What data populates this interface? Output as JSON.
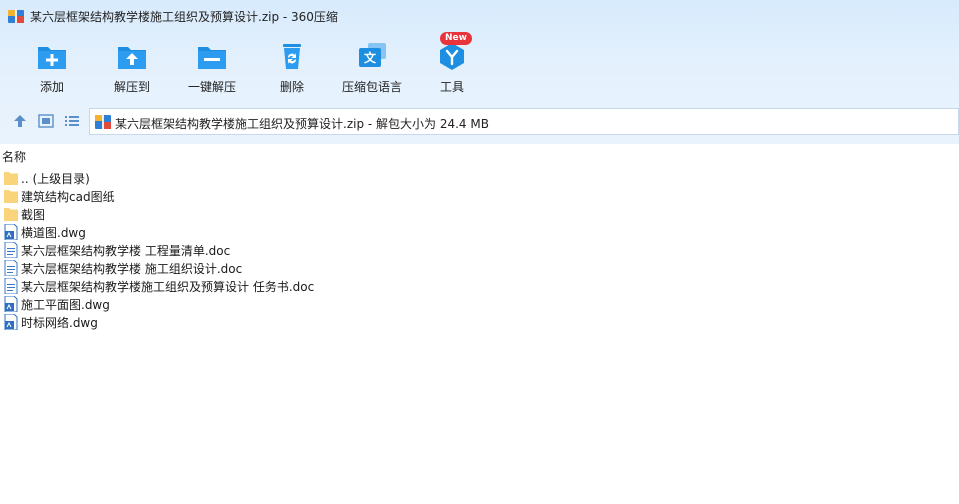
{
  "window": {
    "title": "某六层框架结构教学楼施工组织及预算设计.zip - 360压缩",
    "app_icon": "archive-icon"
  },
  "toolbar": {
    "buttons": [
      {
        "label": "添加",
        "icon": "add-folder-icon"
      },
      {
        "label": "解压到",
        "icon": "extract-folder-icon"
      },
      {
        "label": "一键解压",
        "icon": "one-click-extract-icon"
      },
      {
        "label": "删除",
        "icon": "recycle-bin-icon"
      },
      {
        "label": "压缩包语言",
        "icon": "language-icon"
      },
      {
        "label": "工具",
        "icon": "tools-icon"
      }
    ],
    "new_badge": "New"
  },
  "address": {
    "text": "某六层框架结构教学楼施工组织及预算设计.zip - 解包大小为 24.4 MB"
  },
  "file_list": {
    "column_header": "名称",
    "items": [
      {
        "name": ".. (上级目录)",
        "type": "folder"
      },
      {
        "name": "建筑结构cad图纸",
        "type": "folder"
      },
      {
        "name": "截图",
        "type": "folder"
      },
      {
        "name": "横道图.dwg",
        "type": "dwg"
      },
      {
        "name": "某六层框架结构教学楼 工程量清单.doc",
        "type": "doc"
      },
      {
        "name": "某六层框架结构教学楼 施工组织设计.doc",
        "type": "doc"
      },
      {
        "name": "某六层框架结构教学楼施工组织及预算设计 任务书.doc",
        "type": "doc"
      },
      {
        "name": "施工平面图.dwg",
        "type": "dwg"
      },
      {
        "name": "时标网络.dwg",
        "type": "dwg"
      }
    ]
  },
  "colors": {
    "accent": "#1e8fe0",
    "folder": "#f9d47a",
    "badge": "#e8333a"
  }
}
